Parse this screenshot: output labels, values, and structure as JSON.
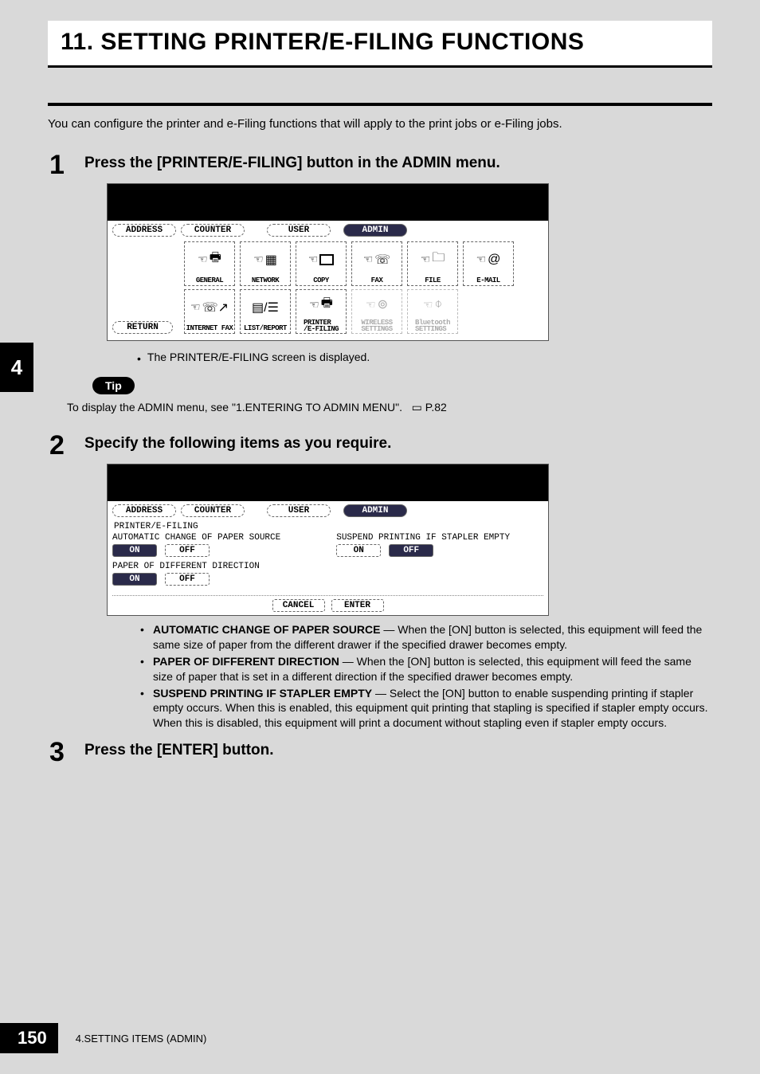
{
  "chapter": {
    "title": "11. SETTING PRINTER/E-FILING FUNCTIONS"
  },
  "intro": "You can configure the printer and e-Filing functions that will apply to the print jobs or e-Filing jobs.",
  "steps": [
    {
      "num": "1",
      "title": "Press the [PRINTER/E-FILING] button in the ADMIN menu."
    },
    {
      "num": "2",
      "title": "Specify the following items as you require."
    },
    {
      "num": "3",
      "title": "Press the [ENTER] button."
    }
  ],
  "screen1": {
    "tabs": {
      "address": "ADDRESS",
      "counter": "COUNTER",
      "user": "USER",
      "admin": "ADMIN"
    },
    "return": "RETURN",
    "row1": [
      {
        "name": "general",
        "label": "GENERAL"
      },
      {
        "name": "network",
        "label": "NETWORK"
      },
      {
        "name": "copy",
        "label": "COPY"
      },
      {
        "name": "fax",
        "label": "FAX"
      },
      {
        "name": "file",
        "label": "FILE"
      },
      {
        "name": "email",
        "label": "E-MAIL"
      }
    ],
    "row2": [
      {
        "name": "internet-fax",
        "label": "INTERNET FAX",
        "dim": false
      },
      {
        "name": "list-report",
        "label": "LIST/REPORT",
        "dim": false
      },
      {
        "name": "printer-efiling",
        "label": "PRINTER\n/E-FILING",
        "dim": false
      },
      {
        "name": "wireless-settings",
        "label": "WIRELESS\nSETTINGS",
        "dim": true
      },
      {
        "name": "bluetooth-settings",
        "label": "Bluetooth\nSETTINGS",
        "dim": true
      }
    ]
  },
  "step1_note": "The PRINTER/E-FILING screen is displayed.",
  "tip": {
    "badge": "Tip",
    "text": "To display the ADMIN menu, see \"1.ENTERING TO ADMIN MENU\".",
    "ref": "P.82"
  },
  "screen2": {
    "tabs": {
      "address": "ADDRESS",
      "counter": "COUNTER",
      "user": "USER",
      "admin": "ADMIN"
    },
    "breadcrumb": "PRINTER/E-FILING",
    "opts": {
      "auto_source": {
        "title": "AUTOMATIC CHANGE OF PAPER SOURCE",
        "on": "ON",
        "off": "OFF",
        "selected": "on"
      },
      "diff_dir": {
        "title": "PAPER OF DIFFERENT DIRECTION",
        "on": "ON",
        "off": "OFF",
        "selected": "on"
      },
      "suspend": {
        "title": "SUSPEND PRINTING IF STAPLER EMPTY",
        "on": "ON",
        "off": "OFF",
        "selected": "off"
      }
    },
    "buttons": {
      "cancel": "CANCEL",
      "enter": "ENTER"
    }
  },
  "descriptions": [
    {
      "term": "AUTOMATIC CHANGE OF PAPER SOURCE",
      "body": " — When the [ON] button is selected, this equipment will feed the same size of paper from the different drawer if the specified drawer becomes empty."
    },
    {
      "term": "PAPER OF DIFFERENT DIRECTION",
      "body": " — When the [ON] button is selected, this equipment will feed the same size of paper that is set in a different direction if the specified drawer becomes empty."
    },
    {
      "term": "SUSPEND PRINTING IF STAPLER EMPTY",
      "body": " — Select the [ON] button to enable suspending printing if stapler empty occurs.  When this is enabled, this equipment quit printing that stapling is specified if stapler empty occurs.  When this is disabled, this equipment will print a document without stapling even if stapler empty occurs."
    }
  ],
  "sidebar": {
    "chapter_tab": "4"
  },
  "footer": {
    "page": "150",
    "section": "4.SETTING ITEMS (ADMIN)"
  }
}
